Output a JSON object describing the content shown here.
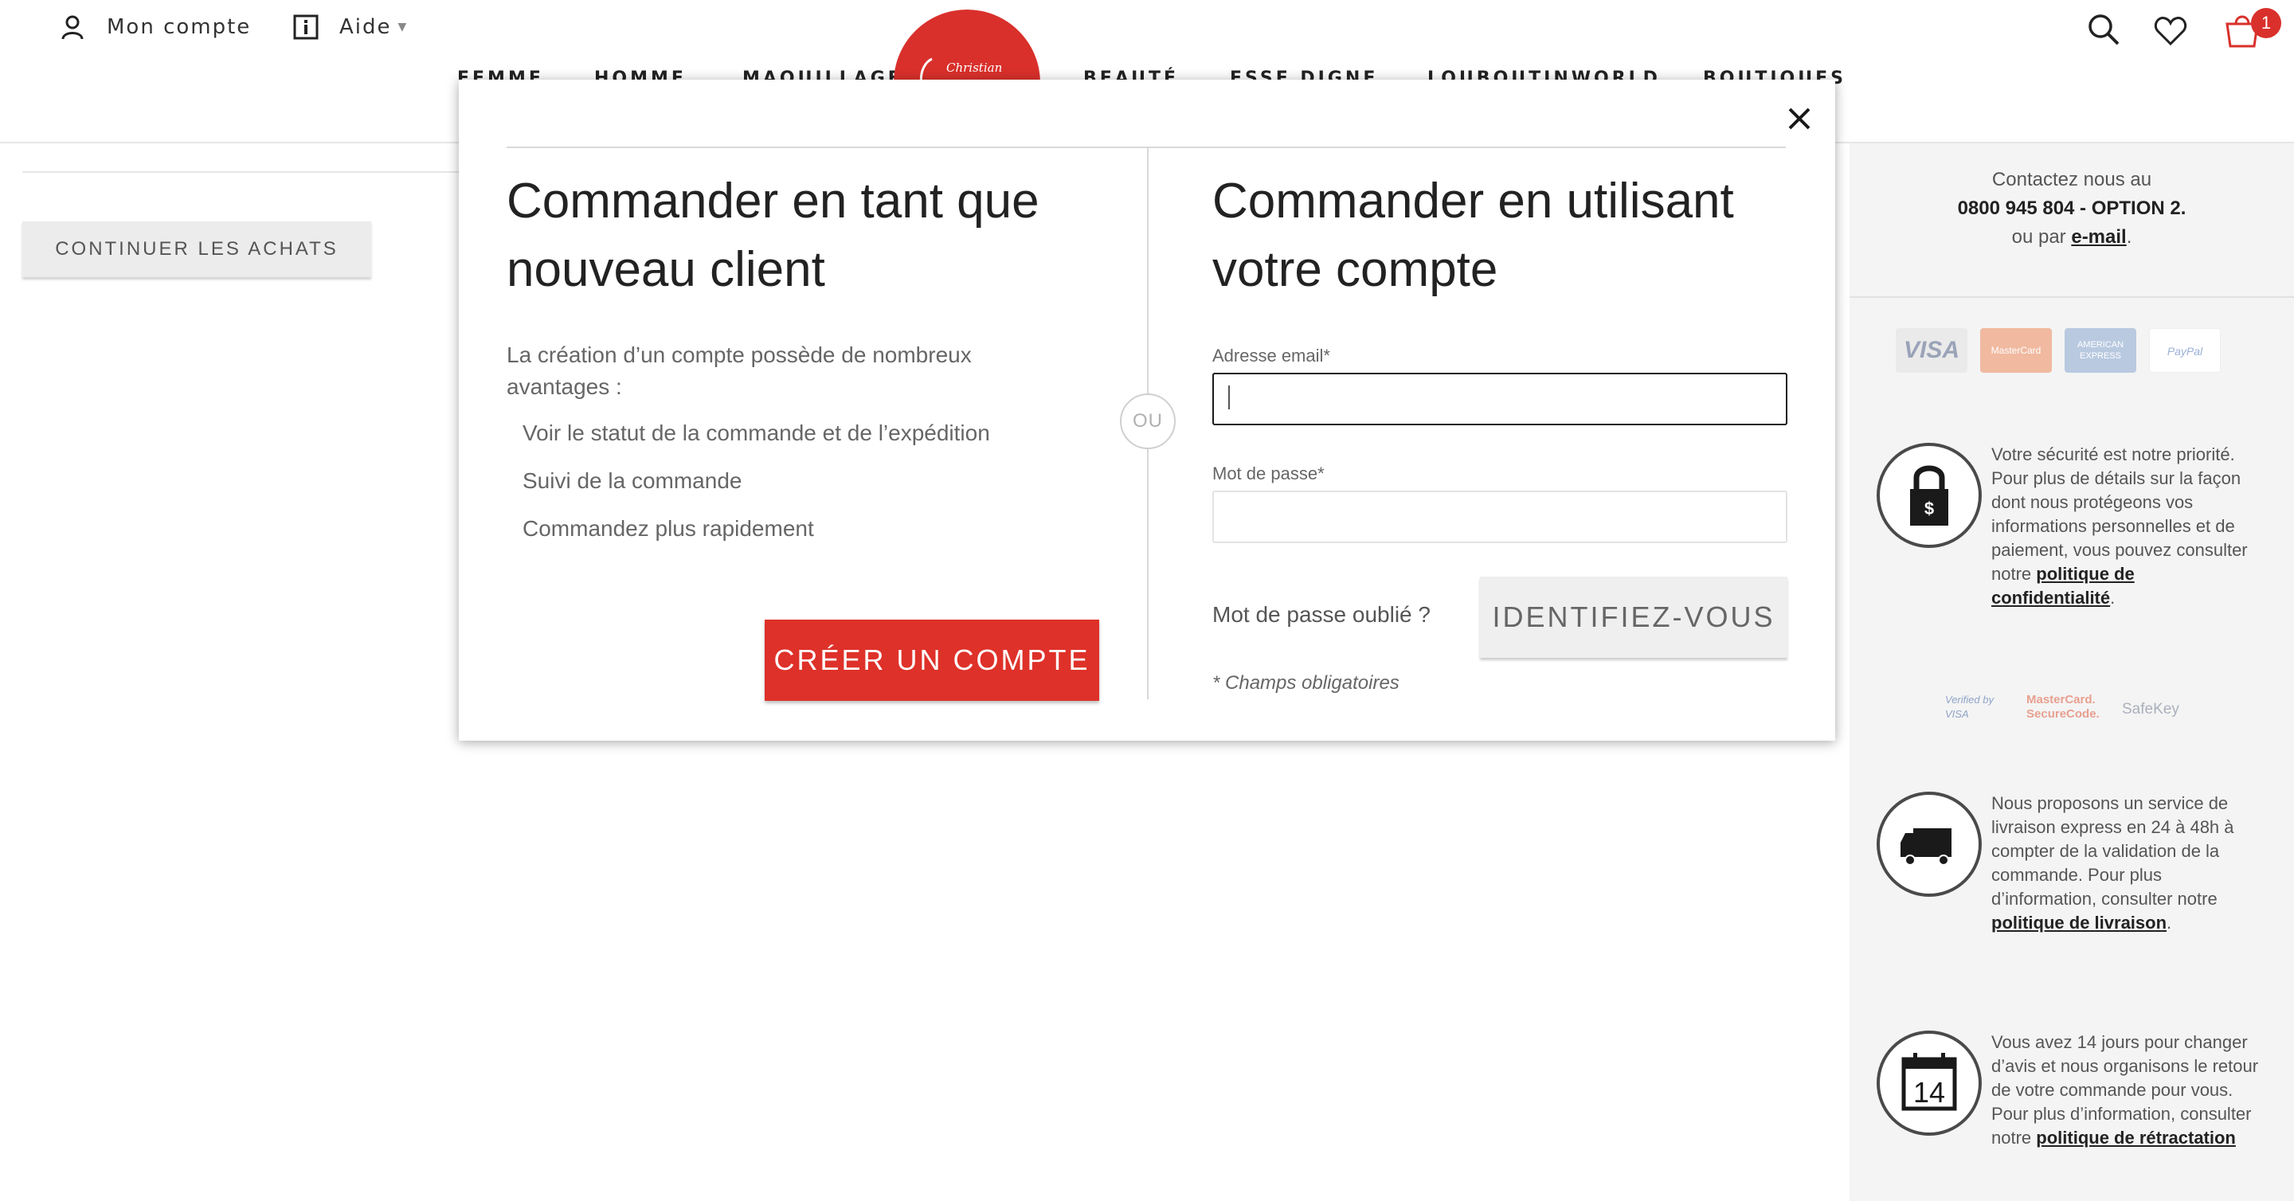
{
  "header": {
    "account_label": "Mon compte",
    "help_label": "Aide",
    "logo_text": "Christian",
    "nav_items": [
      "FEMME",
      "HOMME",
      "MAQUILLAGE",
      "BEAUTÉ",
      "ESSE DIGNE",
      "LOUBOUTINWORLD",
      "BOUTIQUES"
    ],
    "cart_count": "1",
    "brand_color": "#d9302b"
  },
  "page": {
    "continue_label": "CONTINUER LES ACHATS"
  },
  "sidebar": {
    "contact_line1": "Contactez nous au",
    "contact_phone": "0800 945 804 - OPTION 2.",
    "contact_line3_prefix": "ou par",
    "contact_email_link": "e-mail",
    "contact_line3_suffix": ".",
    "cards": [
      "VISA",
      "MasterCard",
      "AMERICAN EXPRESS",
      "PayPal"
    ],
    "security": {
      "text": "Votre sécurité est notre priorité. Pour plus de détails sur la façon dont nous protégeons vos informations personnelles et de paiement, vous pouvez consulter notre",
      "link": "politique de confidentialité",
      "suffix": ".",
      "icon": "padlock-icon"
    },
    "secure_logos": [
      "Verified by VISA",
      "MasterCard. SecureCode.",
      "SafeKey"
    ],
    "delivery": {
      "text": "Nous proposons un service de livraison express en 24 à 48h à compter de la validation de la commande. Pour plus d’information, consulter notre",
      "link": "politique de livraison",
      "suffix": ".",
      "icon": "truck-icon"
    },
    "returns": {
      "text": "Vous avez 14 jours pour changer d’avis et nous organisons le retour de votre commande pour vous. Pour plus d’information, consulter notre",
      "link": "politique de rétractation",
      "icon": "calendar-icon",
      "calendar_number": "14"
    }
  },
  "modal": {
    "left_title": "Commander en tant que nouveau client",
    "intro": "La création d’un compte possède de nombreux avantages :",
    "benefits": [
      "Voir le statut de la commande et de l’expédition",
      "Suivi de la commande",
      "Commandez plus rapidement"
    ],
    "create_label": "CRÉER UN COMPTE",
    "or_label": "OU",
    "right_title": "Commander en utilisant votre compte",
    "email_label": "Adresse email*",
    "email_value": "",
    "password_label": "Mot de passe*",
    "password_value": "",
    "forgot_label": "Mot de passe oublié ?",
    "login_label": "IDENTIFIEZ-VOUS",
    "required_note": "* Champs obligatoires",
    "accent_color": "#de3129"
  }
}
